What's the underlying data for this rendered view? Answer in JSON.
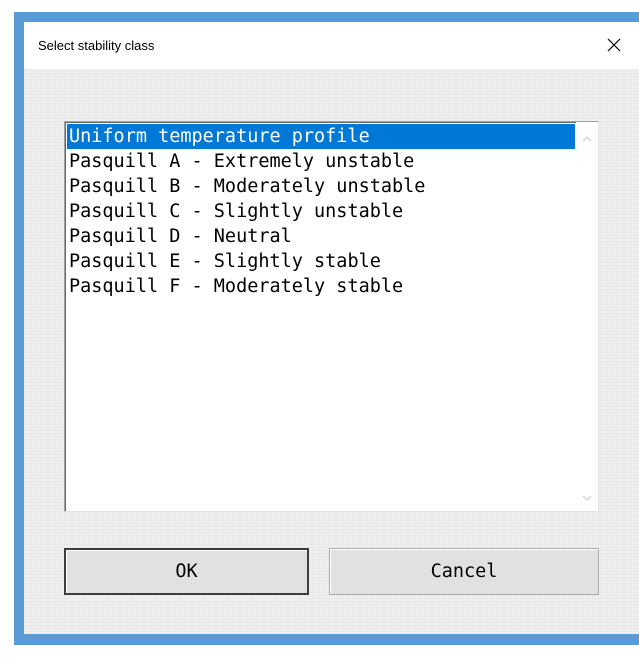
{
  "dialog": {
    "title": "Select stability class",
    "close_icon": "close-icon"
  },
  "listbox": {
    "selected_index": 0,
    "items": [
      "Uniform temperature profile",
      "Pasquill A - Extremely unstable",
      "Pasquill B - Moderately unstable",
      "Pasquill C - Slightly unstable",
      "Pasquill D - Neutral",
      "Pasquill E - Slightly stable",
      "Pasquill F - Moderately stable"
    ],
    "scroll_up_icon": "chevron-up-icon",
    "scroll_down_icon": "chevron-down-icon"
  },
  "buttons": {
    "ok_label": "OK",
    "cancel_label": "Cancel"
  },
  "colors": {
    "window_border": "#5b9bd5",
    "selection": "#0078d7",
    "dialog_bg": "#f0f0f0"
  }
}
